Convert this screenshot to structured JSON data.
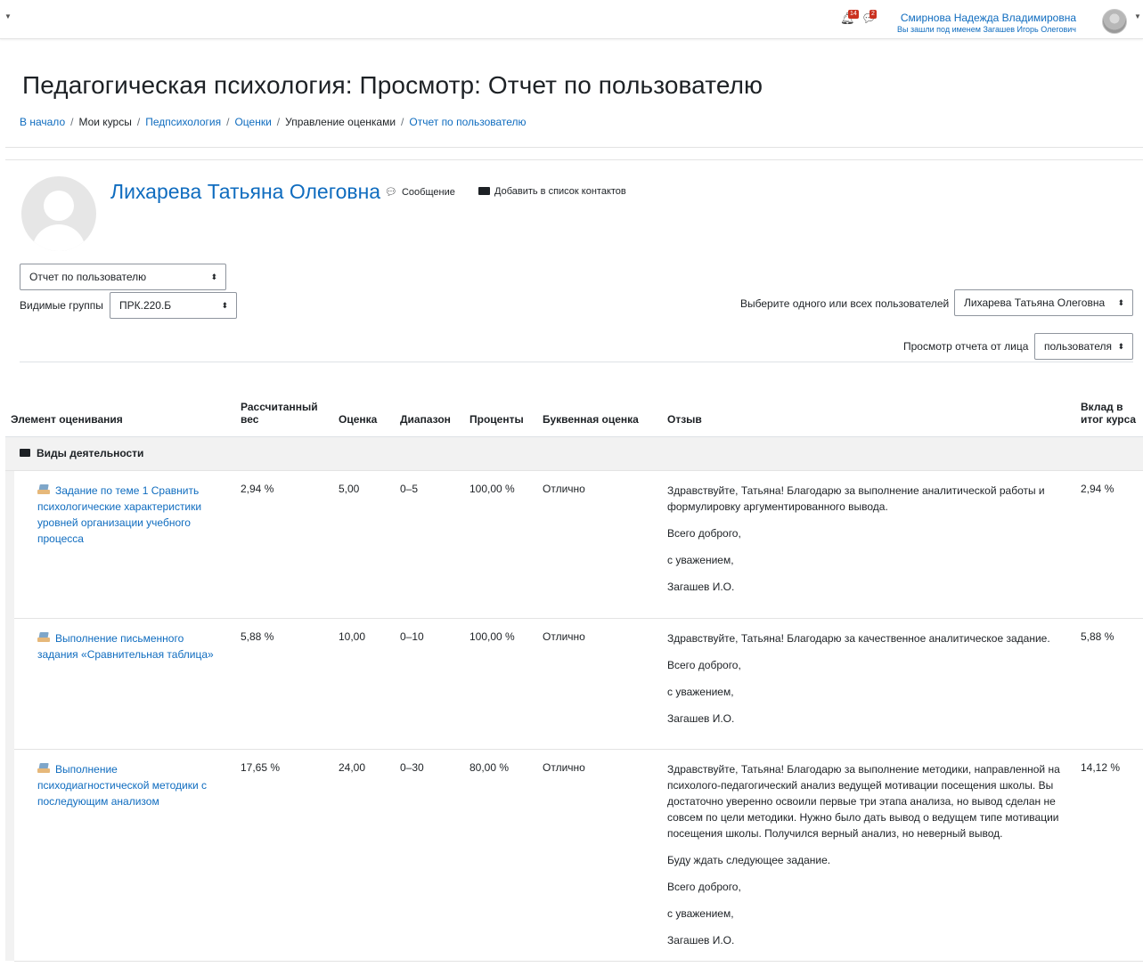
{
  "navbar": {
    "notifications_count": "14",
    "messages_count": "2",
    "user_name": "Смирнова Надежда Владимировна",
    "logged_in_as": "Вы зашли под именем Загашев Игорь Олегович"
  },
  "header": {
    "title": "Педагогическая психология: Просмотр: Отчет по пользователю",
    "breadcrumb": [
      "В начало",
      "Мои курсы",
      "Педпсихология",
      "Оценки",
      "Управление оценками",
      "Отчет по пользователю"
    ]
  },
  "user": {
    "name": "Лихарева Татьяна Олеговна",
    "message_label": "Сообщение",
    "add_contact_label": "Добавить в список контактов"
  },
  "controls": {
    "report_select": "Отчет по пользователю",
    "groups_label": "Видимые группы",
    "groups_select": "ПРК.220.Б",
    "users_label": "Выберите одного или всех пользователей",
    "users_select": "Лихарева Татьяна Олеговна",
    "view_as_label": "Просмотр отчета от лица",
    "view_as_select": "пользователя"
  },
  "table": {
    "headers": {
      "item": "Элемент оценивания",
      "weight": "Рассчитанный вес",
      "grade": "Оценка",
      "range": "Диапазон",
      "percent": "Проценты",
      "letter": "Буквенная оценка",
      "feedback": "Отзыв",
      "contribution": "Вклад в итог курса"
    },
    "category": "Виды деятельности",
    "rows": [
      {
        "item": "Задание по теме 1 Сравнить психологические характеристики уровней организации учебного процесса",
        "weight": "2,94 %",
        "grade": "5,00",
        "range": "0–5",
        "percent": "100,00 %",
        "letter": "Отлично",
        "feedback": [
          "Здравствуйте, Татьяна! Благодарю за выполнение аналитической работы и формулировку аргументированного вывода.",
          "Всего доброго,",
          "с уважением,",
          "Загашев И.О."
        ],
        "contribution": "2,94 %"
      },
      {
        "item": "Выполнение письменного задания «Сравнительная таблица»",
        "weight": "5,88 %",
        "grade": "10,00",
        "range": "0–10",
        "percent": "100,00 %",
        "letter": "Отлично",
        "feedback": [
          "Здравствуйте, Татьяна! Благодарю за качественное аналитическое задание.",
          "Всего доброго,",
          "с уважением,",
          "Загашев И.О."
        ],
        "contribution": "5,88 %"
      },
      {
        "item": "Выполнение психодиагностической методики с последующим анализом",
        "weight": "17,65 %",
        "grade": "24,00",
        "range": "0–30",
        "percent": "80,00 %",
        "letter": "Отлично",
        "feedback": [
          "Здравствуйте, Татьяна! Благодарю за выполнение методики, направленной на психолого-педагогический анализ ведущей мотивации посещения школы. Вы достаточно уверенно освоили первые три этапа анализа, но вывод сделан не совсем по цели методики. Нужно было дать вывод о ведущем типе мотивации посещения школы. Получился верный анализ, но неверный вывод.",
          "Буду ждать следующее задание.",
          "Всего доброго,",
          "с уважением,",
          "Загашев И.О."
        ],
        "contribution": "14,12 %"
      }
    ]
  }
}
